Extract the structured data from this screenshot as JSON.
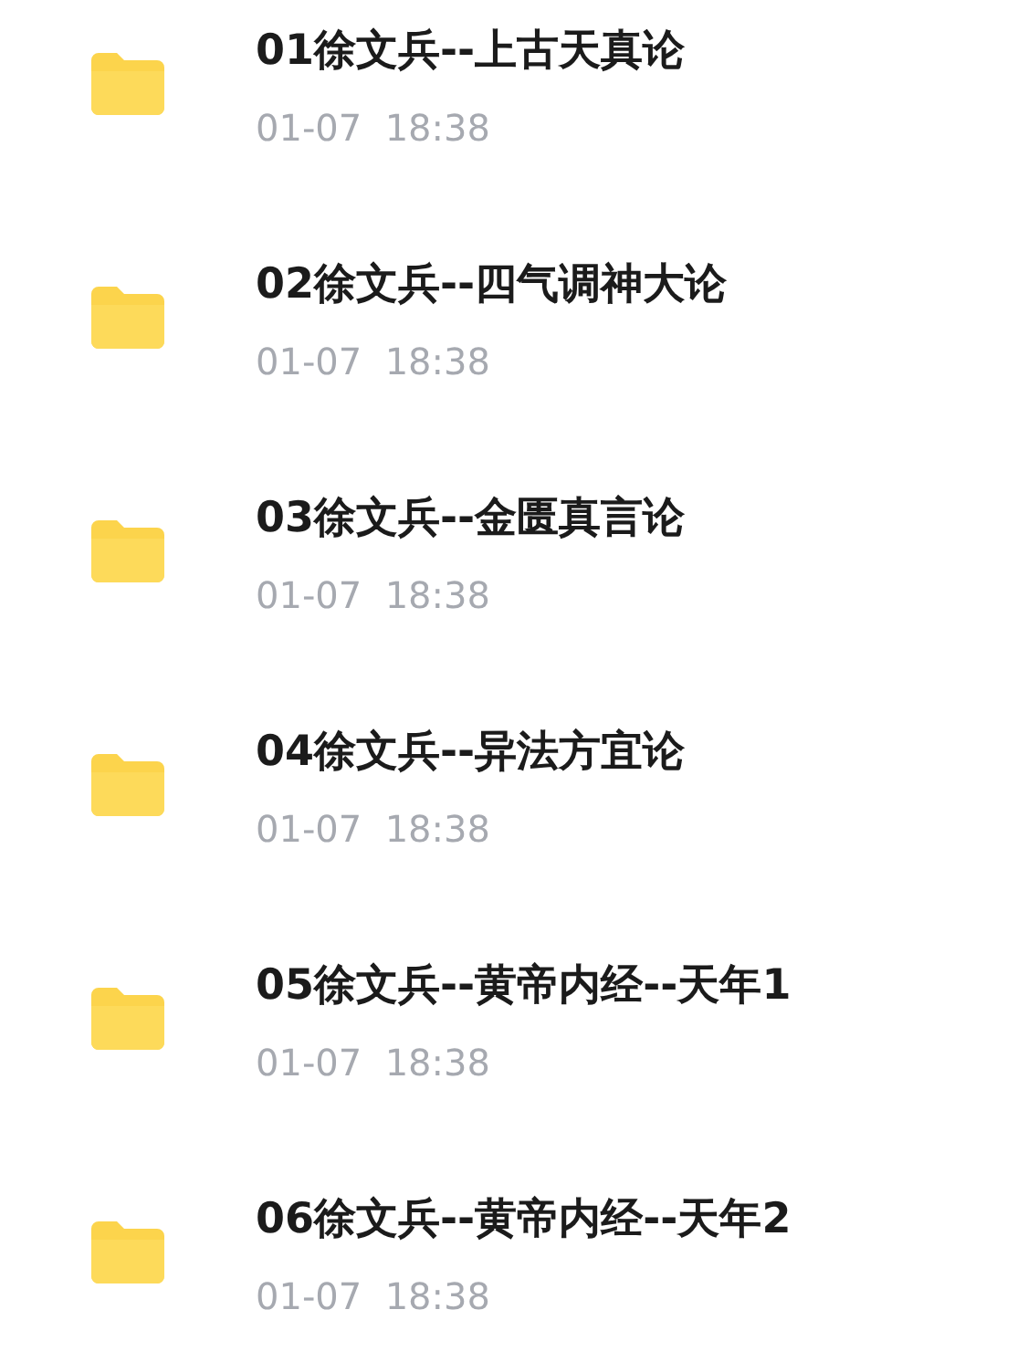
{
  "files": [
    {
      "name": "01徐文兵--上古天真论",
      "date": "01-07  18:38"
    },
    {
      "name": "02徐文兵--四气调神大论",
      "date": "01-07  18:38"
    },
    {
      "name": "03徐文兵--金匮真言论",
      "date": "01-07  18:38"
    },
    {
      "name": "04徐文兵--异法方宜论",
      "date": "01-07  18:38"
    },
    {
      "name": "05徐文兵--黄帝内经--天年1",
      "date": "01-07  18:38"
    },
    {
      "name": "06徐文兵--黄帝内经--天年2",
      "date": "01-07  18:38"
    }
  ]
}
